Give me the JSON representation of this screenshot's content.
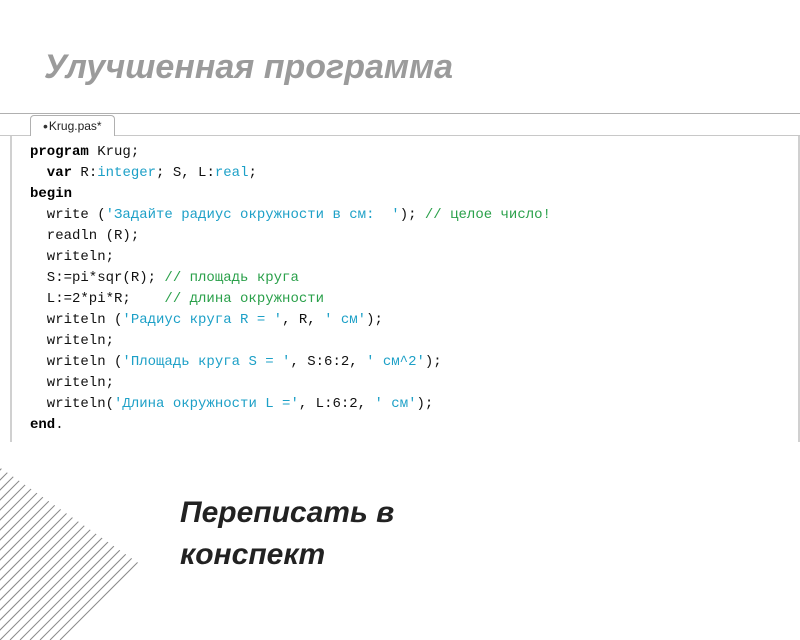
{
  "title": "Улучшенная программа",
  "tab": {
    "label": "Krug.pas*"
  },
  "code": {
    "l1_kw_program": "program",
    "l1_name": " Krug;",
    "l2_kw_var": "  var",
    "l2_decl1": " R:",
    "l2_t1": "integer",
    "l2_decl2": "; S, L:",
    "l2_t2": "real",
    "l2_end": ";",
    "l3_begin": "begin",
    "l4a": "  write (",
    "l4s": "'Задайте радиус окружности в см:  '",
    "l4b": "); ",
    "l4c": "// целое число!",
    "l5": "  readln (R);",
    "l6": "  writeln;",
    "l7a": "  S:=pi*sqr(R); ",
    "l7c": "// площадь круга",
    "l8a": "  L:=2*pi*R;    ",
    "l8c": "// длина окружности",
    "l9a": "  writeln (",
    "l9s1": "'Радиус круга R = '",
    "l9b": ", R, ",
    "l9s2": "' см'",
    "l9c": ");",
    "l10": "  writeln;",
    "l11a": "  writeln (",
    "l11s1": "'Площадь круга S = '",
    "l11b": ", S:6:2, ",
    "l11s2": "' см^2'",
    "l11c": ");",
    "l12": "  writeln;",
    "l13a": "  writeln(",
    "l13s1": "'Длина окружности L ='",
    "l13b": ", L:6:2, ",
    "l13s2": "' см'",
    "l13c": ");",
    "l14_end": "end",
    "l14_dot": "."
  },
  "subtitle_line1": "Переписать в",
  "subtitle_line2": "конспект"
}
